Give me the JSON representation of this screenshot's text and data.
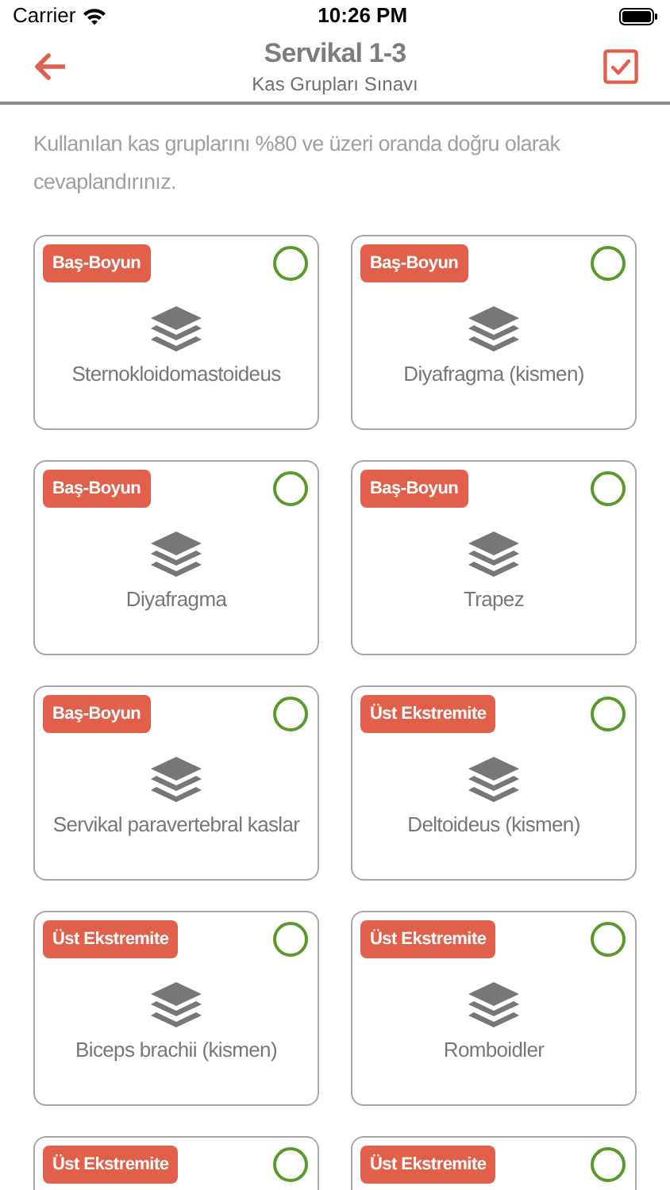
{
  "status_bar": {
    "carrier": "Carrier",
    "time": "10:26 PM"
  },
  "nav": {
    "title": "Servikal 1-3",
    "subtitle": "Kas Grupları Sınavı"
  },
  "instructions": "Kullanılan kas gruplarını %80 ve üzeri oranda doğru olarak cevaplandırınız.",
  "cards": [
    {
      "tag": "Baş-Boyun",
      "name": "Sternokloidomastoideus",
      "selected": false
    },
    {
      "tag": "Baş-Boyun",
      "name": "Diyafragma (kismen)",
      "selected": false
    },
    {
      "tag": "Baş-Boyun",
      "name": "Diyafragma",
      "selected": false
    },
    {
      "tag": "Baş-Boyun",
      "name": "Trapez",
      "selected": false
    },
    {
      "tag": "Baş-Boyun",
      "name": "Servikal paravertebral kaslar",
      "selected": false
    },
    {
      "tag": "Üst Ekstremite",
      "name": "Deltoideus (kismen)",
      "selected": false
    },
    {
      "tag": "Üst Ekstremite",
      "name": "Biceps brachii (kismen)",
      "selected": false
    },
    {
      "tag": "Üst Ekstremite",
      "name": "Romboidler",
      "selected": false
    },
    {
      "tag": "Üst Ekstremite",
      "selected": false
    },
    {
      "tag": "Üst Ekstremite",
      "selected": false
    }
  ]
}
